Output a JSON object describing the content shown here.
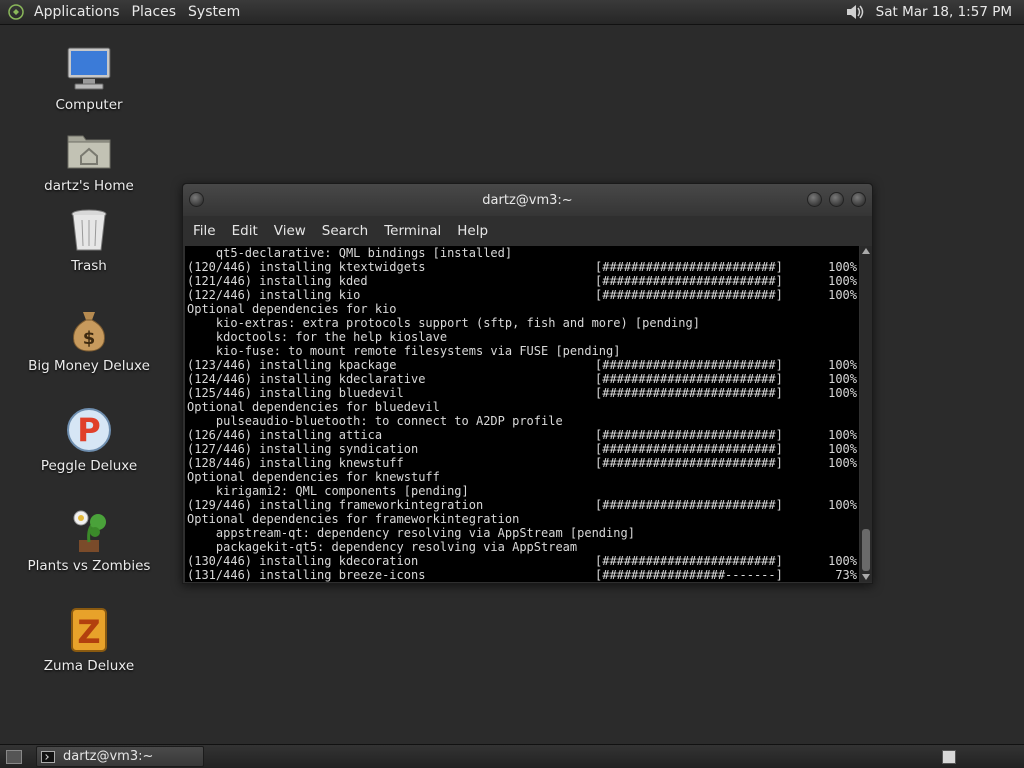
{
  "top_panel": {
    "menus": [
      "Applications",
      "Places",
      "System"
    ],
    "clock": "Sat Mar 18,  1:57 PM"
  },
  "desktop": {
    "icons": [
      {
        "label": "Computer",
        "icon": "computer-icon"
      },
      {
        "label": "dartz's Home",
        "icon": "home-folder-icon"
      },
      {
        "label": "Trash",
        "icon": "trash-icon"
      },
      {
        "label": "Big Money Deluxe",
        "icon": "money-bag-icon"
      },
      {
        "label": "Peggle Deluxe",
        "icon": "peggle-icon"
      },
      {
        "label": "Plants vs Zombies",
        "icon": "plants-vs-zombies-icon"
      },
      {
        "label": "Zuma Deluxe",
        "icon": "zuma-icon"
      }
    ]
  },
  "terminal": {
    "title": "dartz@vm3:~",
    "menus": [
      "File",
      "Edit",
      "View",
      "Search",
      "Terminal",
      "Help"
    ],
    "lines": [
      {
        "text": "    qt5-declarative: QML bindings [installed]"
      },
      {
        "text": "(120/446) installing ktextwidgets",
        "bar": "[########################]",
        "pct": "100%"
      },
      {
        "text": "(121/446) installing kded",
        "bar": "[########################]",
        "pct": "100%"
      },
      {
        "text": "(122/446) installing kio",
        "bar": "[########################]",
        "pct": "100%"
      },
      {
        "text": "Optional dependencies for kio"
      },
      {
        "text": "    kio-extras: extra protocols support (sftp, fish and more) [pending]"
      },
      {
        "text": "    kdoctools: for the help kioslave"
      },
      {
        "text": "    kio-fuse: to mount remote filesystems via FUSE [pending]"
      },
      {
        "text": "(123/446) installing kpackage",
        "bar": "[########################]",
        "pct": "100%"
      },
      {
        "text": "(124/446) installing kdeclarative",
        "bar": "[########################]",
        "pct": "100%"
      },
      {
        "text": "(125/446) installing bluedevil",
        "bar": "[########################]",
        "pct": "100%"
      },
      {
        "text": "Optional dependencies for bluedevil"
      },
      {
        "text": "    pulseaudio-bluetooth: to connect to A2DP profile"
      },
      {
        "text": "(126/446) installing attica",
        "bar": "[########################]",
        "pct": "100%"
      },
      {
        "text": "(127/446) installing syndication",
        "bar": "[########################]",
        "pct": "100%"
      },
      {
        "text": "(128/446) installing knewstuff",
        "bar": "[########################]",
        "pct": "100%"
      },
      {
        "text": "Optional dependencies for knewstuff"
      },
      {
        "text": "    kirigami2: QML components [pending]"
      },
      {
        "text": "(129/446) installing frameworkintegration",
        "bar": "[########################]",
        "pct": "100%"
      },
      {
        "text": "Optional dependencies for frameworkintegration"
      },
      {
        "text": "    appstream-qt: dependency resolving via AppStream [pending]"
      },
      {
        "text": "    packagekit-qt5: dependency resolving via AppStream"
      },
      {
        "text": "(130/446) installing kdecoration",
        "bar": "[########################]",
        "pct": "100%"
      },
      {
        "text": "(131/446) installing breeze-icons",
        "bar": "[#################-------]",
        "pct": "73%"
      }
    ]
  },
  "bottom_panel": {
    "task_label": "dartz@vm3:~"
  }
}
